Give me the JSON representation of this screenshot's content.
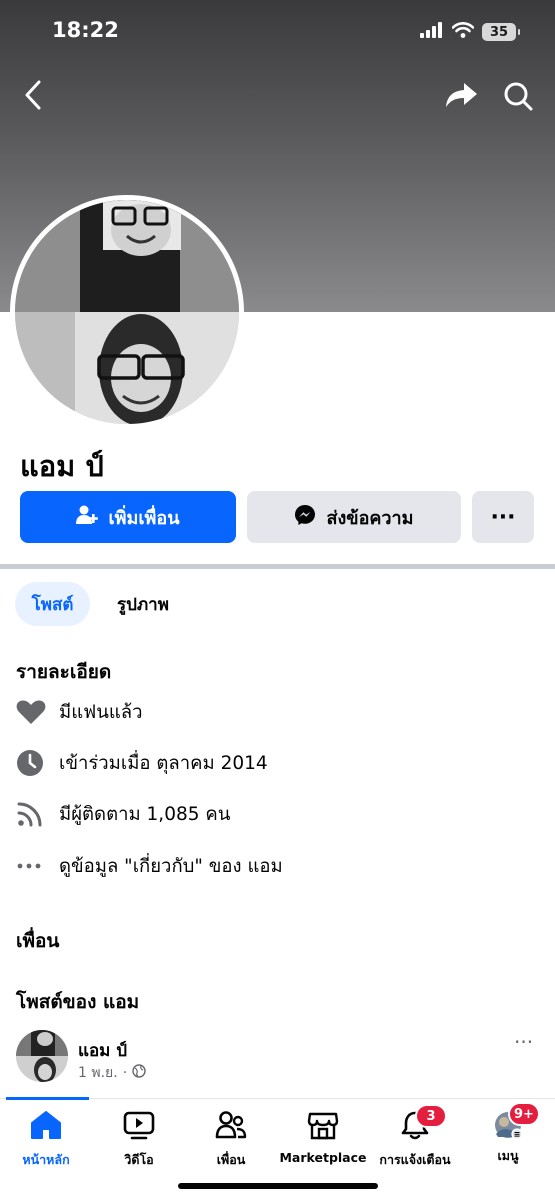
{
  "status_bar": {
    "time": "18:22",
    "battery": "35"
  },
  "profile": {
    "name": "แอม ป์",
    "add_friend_label": "เพิ่มเพื่อน",
    "message_label": "ส่งข้อความ",
    "more_label": "···"
  },
  "tabs": [
    {
      "label": "โพสต์",
      "active": true
    },
    {
      "label": "รูปภาพ",
      "active": false
    }
  ],
  "details": {
    "title": "รายละเอียด",
    "items": [
      {
        "icon": "heart-icon",
        "text": "มีแฟนแล้ว"
      },
      {
        "icon": "clock-icon",
        "text": "เข้าร่วมเมื่อ ตุลาคม 2014"
      },
      {
        "icon": "rss-icon",
        "text": "มีผู้ติดตาม 1,085 คน"
      },
      {
        "icon": "ellipsis-icon",
        "text": "ดูข้อมูล \"เกี่ยวกับ\" ของ แอม"
      }
    ]
  },
  "friends_title": "เพื่อน",
  "posts": {
    "title": "โพสต์ของ แอม",
    "items": [
      {
        "author": "แอม ป์",
        "date": "1 พ.ย.",
        "separator": "·",
        "privacy": "globe-icon"
      }
    ]
  },
  "bottom_nav": {
    "items": [
      {
        "label": "หน้าหลัก",
        "icon": "home-icon",
        "active": true
      },
      {
        "label": "วิดีโอ",
        "icon": "video-icon",
        "active": false
      },
      {
        "label": "เพื่อน",
        "icon": "friends-icon",
        "active": false
      },
      {
        "label": "Marketplace",
        "icon": "marketplace-icon",
        "active": false
      },
      {
        "label": "การแจ้งเตือน",
        "icon": "bell-icon",
        "active": false,
        "badge": "3"
      },
      {
        "label": "เมนู",
        "icon": "menu-avatar-icon",
        "active": false,
        "badge": "9+"
      }
    ]
  },
  "colors": {
    "accent": "#0866ff",
    "badge": "#e41e3f",
    "secondary_button": "#e4e6eb"
  }
}
